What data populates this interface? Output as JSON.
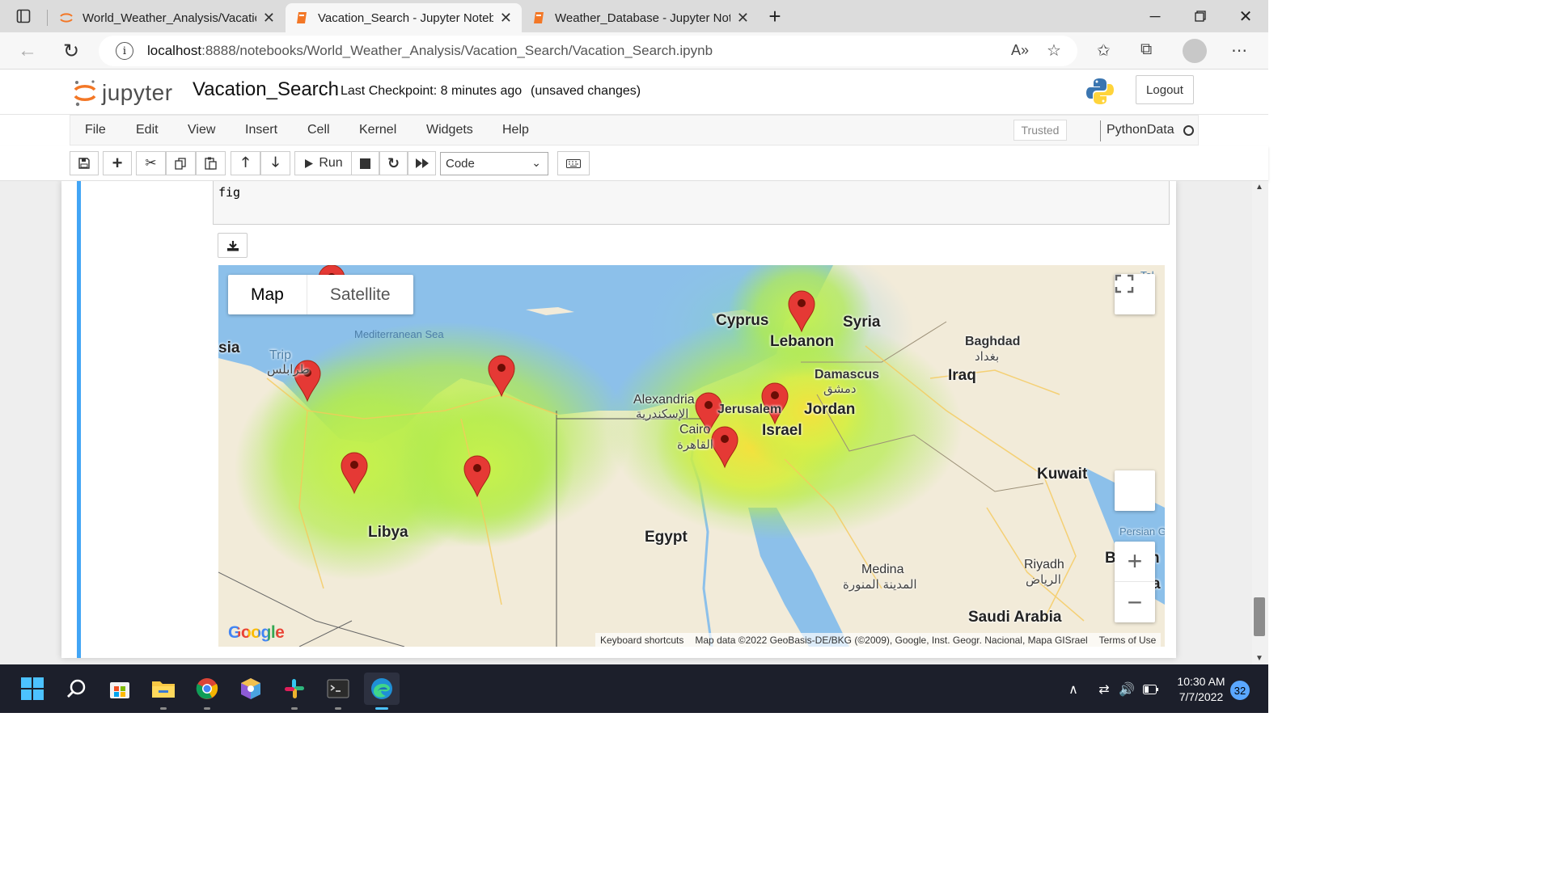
{
  "browser": {
    "tabs": [
      {
        "title": "World_Weather_Analysis/Vacatio",
        "active": false
      },
      {
        "title": "Vacation_Search - Jupyter Noteb",
        "active": true
      },
      {
        "title": "Weather_Database - Jupyter Not",
        "active": false
      }
    ],
    "url_host": "localhost",
    "url_path": ":8888/notebooks/World_Weather_Analysis/Vacation_Search/Vacation_Search.ipynb"
  },
  "jupyter": {
    "logo_text": "jupyter",
    "notebook_name": "Vacation_Search",
    "checkpoint": "Last Checkpoint: 8 minutes ago",
    "unsaved": "(unsaved changes)",
    "logout_label": "Logout",
    "menu": [
      "File",
      "Edit",
      "View",
      "Insert",
      "Cell",
      "Kernel",
      "Widgets",
      "Help"
    ],
    "trusted_label": "Trusted",
    "kernel_name": "PythonData",
    "run_label": "Run",
    "cell_type": "Code"
  },
  "cell": {
    "code": "fig"
  },
  "map": {
    "map_type": {
      "map": "Map",
      "satellite": "Satellite",
      "selected": "Map"
    },
    "labels": {
      "mediterranean": "Mediterranean Sea",
      "cyprus": "Cyprus",
      "syria": "Syria",
      "lebanon": "Lebanon",
      "baghdad": "Baghdad",
      "baghdad_ar": "بغداد",
      "iraq": "Iraq",
      "damascus": "Damascus",
      "damascus_ar": "دمشق",
      "jordan": "Jordan",
      "israel": "Israel",
      "jerusalem": "Jerusalem",
      "alexandria": "Alexandria",
      "alexandria_ar": "الإسكندرية",
      "cairo": "Cairo",
      "cairo_ar": "القاهرة",
      "tripoli": "Trip",
      "tripoli_ar": "طرابلس",
      "sia": "sia",
      "libya": "Libya",
      "egypt": "Egypt",
      "kuwait": "Kuwait",
      "persian": "Persian G",
      "medina": "Medina",
      "medina_ar": "المدينة المنورة",
      "riyadh": "Riyadh",
      "riyadh_ar": "الرياض",
      "saudi": "Saudi Arabia",
      "b_partial": "B",
      "n_partial": "n",
      "a_partial": "a",
      "turkey_partial": "Tel"
    },
    "attribution": {
      "shortcuts": "Keyboard shortcuts",
      "data": "Map data ©2022 GeoBasis-DE/BKG (©2009), Google, Inst. Geogr. Nacional, Mapa GISrael",
      "terms": "Terms of Use"
    },
    "google_logo": "Google",
    "markers": 9
  },
  "taskbar": {
    "time": "10:30 AM",
    "date": "7/7/2022",
    "notifications": "32"
  },
  "colors": {
    "accent_blue": "#42a5f5",
    "marker_red": "#e53935",
    "jupyter_orange": "#f37726",
    "taskbar": "#1c1f2b"
  }
}
